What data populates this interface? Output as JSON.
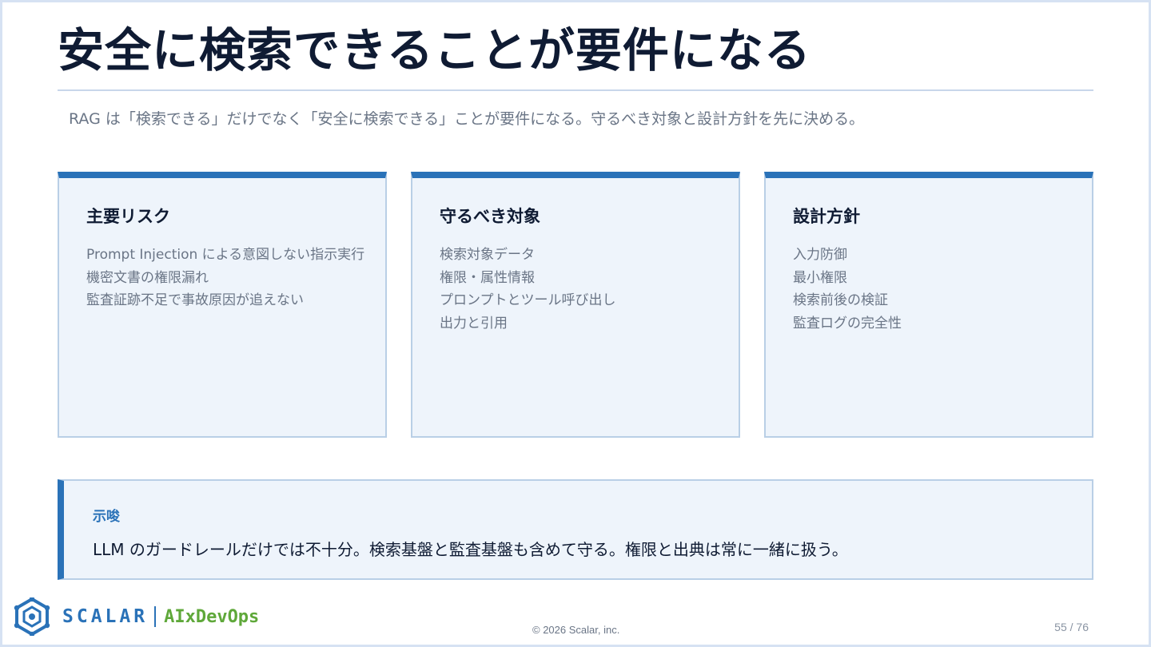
{
  "slide": {
    "title": "安全に検索できることが要件になる",
    "subtitle": "RAG は「検索できる」だけでなく「安全に検索できる」ことが要件になる。守るべき対象と設計方針を先に決める。"
  },
  "cards": [
    {
      "title": "主要リスク",
      "items": [
        "Prompt Injection による意図しない指示実行",
        "機密文書の権限漏れ",
        "監査証跡不足で事故原因が追えない"
      ]
    },
    {
      "title": "守るべき対象",
      "items": [
        "検索対象データ",
        "権限・属性情報",
        "プロンプトとツール呼び出し",
        "出力と引用"
      ]
    },
    {
      "title": "設計方針",
      "items": [
        "入力防御",
        "最小権限",
        "検索前後の検証",
        "監査ログの完全性"
      ]
    }
  ],
  "insight": {
    "label": "示唆",
    "text": "LLM のガードレールだけでは不十分。検索基盤と監査基盤も含めて守る。権限と出典は常に一緒に扱う。"
  },
  "footer": {
    "brand": "SCALAR",
    "product": "AIxDevOps",
    "logo_icon": "scalar-logo-icon",
    "copyright": "© 2026 Scalar, inc.",
    "page": "55 / 76"
  },
  "colors": {
    "accent": "#2a72b8",
    "title": "#0f1b33",
    "muted": "#6a7586",
    "card_bg": "#eef4fb",
    "product_green": "#5fa83a"
  }
}
